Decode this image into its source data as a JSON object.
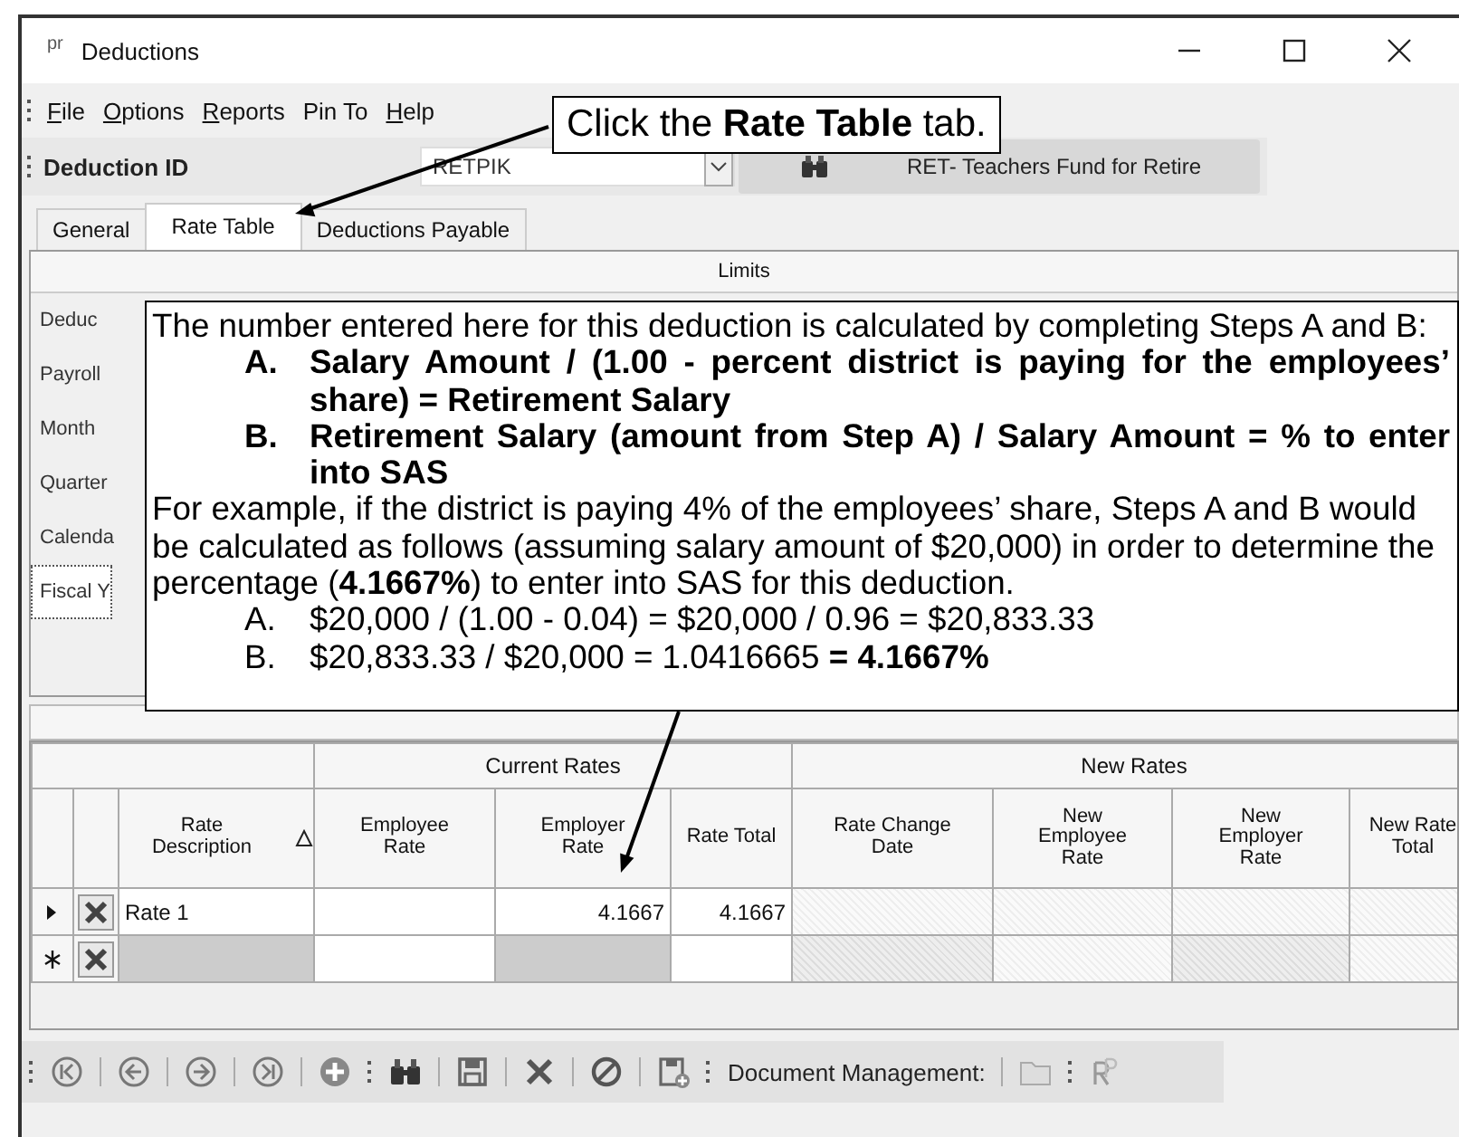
{
  "window": {
    "app_icon": "pr",
    "title": "Deductions"
  },
  "menu": [
    {
      "label": "File",
      "underline_first": true
    },
    {
      "label": "Options",
      "underline_first": true
    },
    {
      "label": "Reports",
      "underline_first": true
    },
    {
      "label": "Pin To",
      "underline_first": false
    },
    {
      "label": "Help",
      "underline_first": true
    }
  ],
  "id_bar": {
    "label": "Deduction ID",
    "value": "RETPIK",
    "lookup": "RET- Teachers Fund for Retire"
  },
  "tabs": [
    {
      "label": "General",
      "selected": false
    },
    {
      "label": "Rate Table",
      "selected": true
    },
    {
      "label": "Deductions Payable",
      "selected": false
    }
  ],
  "limits": {
    "header": "Limits",
    "rows": [
      {
        "label": "Deduc",
        "focused": false
      },
      {
        "label": "Payroll",
        "focused": false
      },
      {
        "label": "Month",
        "focused": false
      },
      {
        "label": "Quarter",
        "focused": false
      },
      {
        "label": "Calenda",
        "focused": false
      },
      {
        "label": "Fiscal Y",
        "focused": true
      }
    ]
  },
  "grid": {
    "groups": [
      {
        "label": "Current Rates",
        "columns": [
          "Employee Rate",
          "Employer Rate",
          "Rate Total"
        ]
      },
      {
        "label": "New Rates",
        "columns": [
          "Rate Change Date",
          "New Employee Rate",
          "New Employer Rate",
          "New Rate Total"
        ]
      }
    ],
    "first_column": {
      "label": "Rate Description",
      "sorted": true
    },
    "rows": [
      {
        "kind": "current",
        "description": "Rate 1",
        "employer_rate": "4.1667",
        "rate_total": "4.1667"
      },
      {
        "kind": "new"
      }
    ]
  },
  "bottom_toolbar": {
    "document_label": "Document Management:"
  },
  "tab_callout": {
    "text": "Click the **Rate Table** tab."
  },
  "note_callout": {
    "intro": "The number entered here for this deduction is calculated by completing Steps A and B:",
    "steps": [
      {
        "letter": "A.",
        "text": "Salary Amount / (1.00 - percent district is paying for the employees’ share) = Retirement Salary"
      },
      {
        "letter": "B.",
        "text": "Retirement Salary (amount from Step A) / Salary Amount = % to enter into SAS"
      }
    ],
    "example": "For example, if the district is paying 4% of the employees’ share, Steps A and B would be calculated as follows (assuming salary amount of $20,000) in order to determine the percentage (**4.1667%**) to enter into SAS for this deduction.",
    "calc": [
      {
        "letter": "A.",
        "text": "$20,000 / (1.00 - 0.04) = $20,000 / 0.96 = $20,833.33"
      },
      {
        "letter": "B.",
        "text": "$20,833.33 / $20,000 = 1.0416665 **= 4.1667%**"
      }
    ]
  }
}
